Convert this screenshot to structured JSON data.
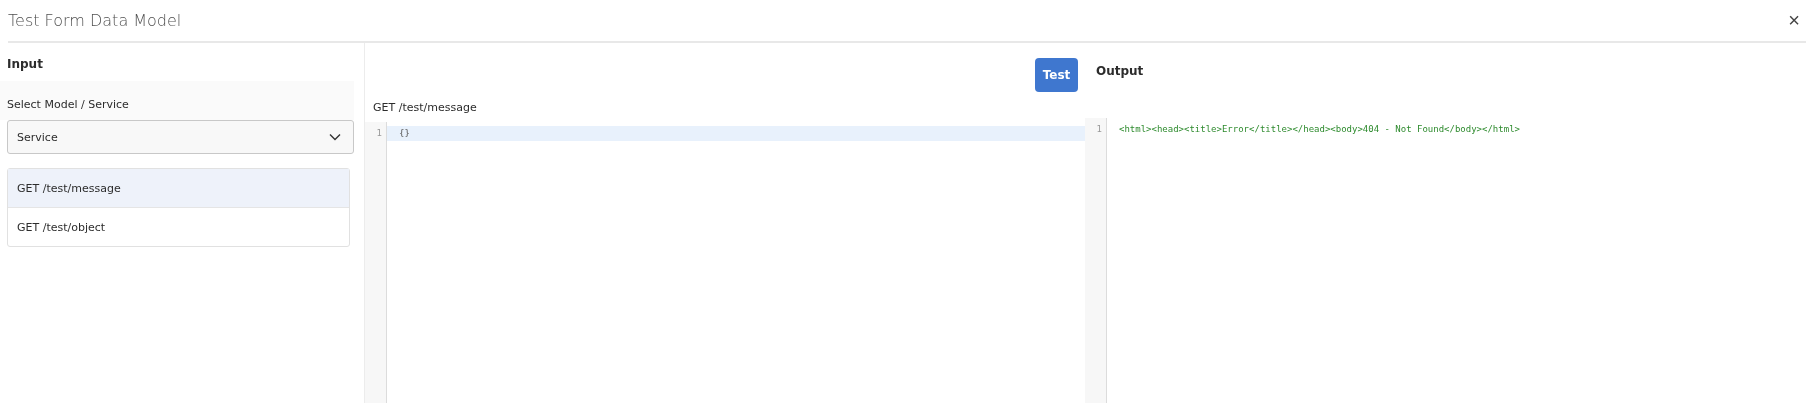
{
  "window": {
    "title": "Test Form Data Model",
    "close": "×"
  },
  "input": {
    "heading": "Input",
    "select_label": "Select Model / Service",
    "select_value": "Service",
    "operations": [
      {
        "label": "GET /test/message",
        "selected": true
      },
      {
        "label": "GET /test/object",
        "selected": false
      }
    ]
  },
  "request": {
    "label": "GET /test/message",
    "lines": [
      {
        "number": "1",
        "code": "{}"
      }
    ]
  },
  "test_button": "Test",
  "output": {
    "heading": "Output",
    "lines": [
      {
        "number": "1",
        "code": "<html><head><title>Error</title></head><body>404 - Not Found</body></html>"
      }
    ]
  }
}
